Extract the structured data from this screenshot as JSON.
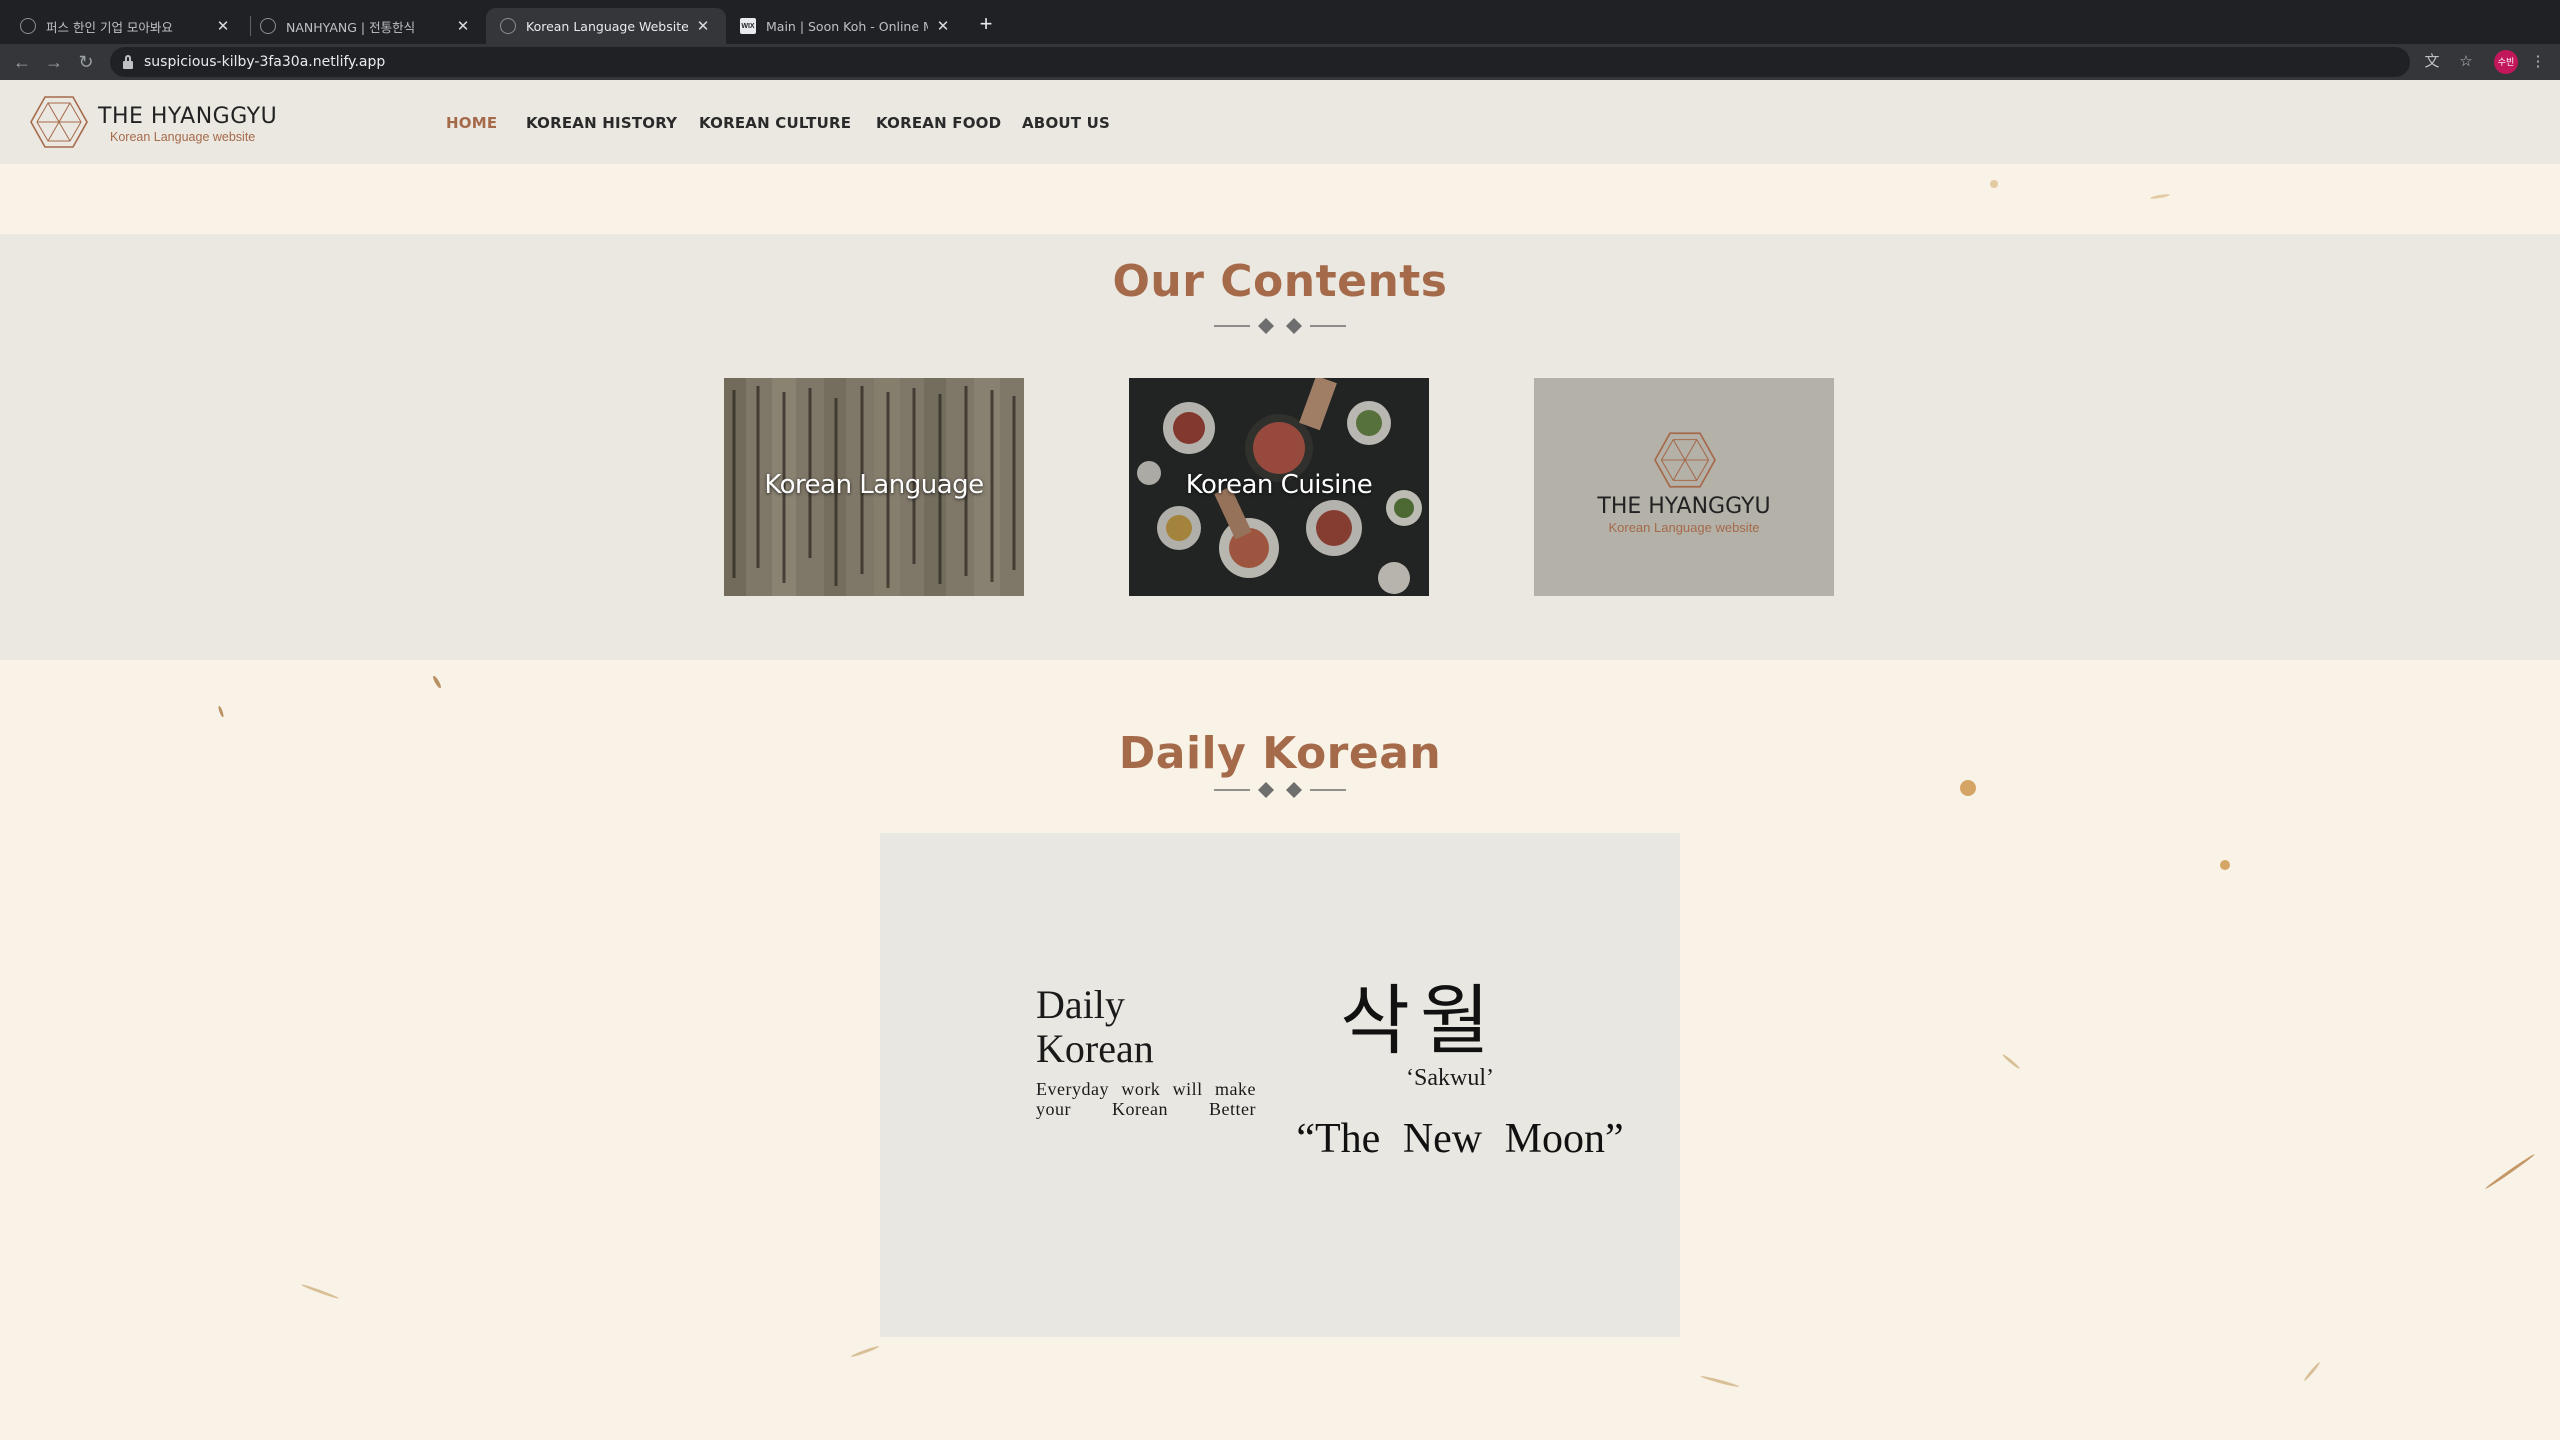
{
  "browser": {
    "tabs": [
      {
        "title": "퍼스 한인 기업 모아봐요"
      },
      {
        "title": "NANHYANG | 전통한식"
      },
      {
        "title": "Korean Language Website"
      },
      {
        "title": "Main | Soon Koh - Online Mark"
      }
    ],
    "url": "suspicious-kilby-3fa30a.netlify.app",
    "profile_initials": "수빈"
  },
  "header": {
    "logo_title": "THE HYANGGYU",
    "logo_subtitle": "Korean Language website",
    "menu": [
      "HOME",
      "KOREAN HISTORY",
      "KOREAN CULTURE",
      "KOREAN FOOD",
      "ABOUT US"
    ]
  },
  "contents": {
    "title": "Our Contents",
    "cards": [
      {
        "label": "Korean Language"
      },
      {
        "label": "Korean Cuisine"
      },
      {
        "logo_title": "THE HYANGGYU",
        "logo_subtitle": "Korean Language website"
      }
    ]
  },
  "daily": {
    "title": "Daily Korean",
    "card_heading_line1": "Daily",
    "card_heading_line2": "Korean",
    "card_description": "Everyday work will make your Korean Better",
    "word": "삭월",
    "romanization": "‘Sakwul’",
    "meaning": "“The New Moon”"
  },
  "colors": {
    "accent": "#a56a4a",
    "header_bg": "#ebe8e2",
    "page_bg": "#f8f3e6"
  }
}
